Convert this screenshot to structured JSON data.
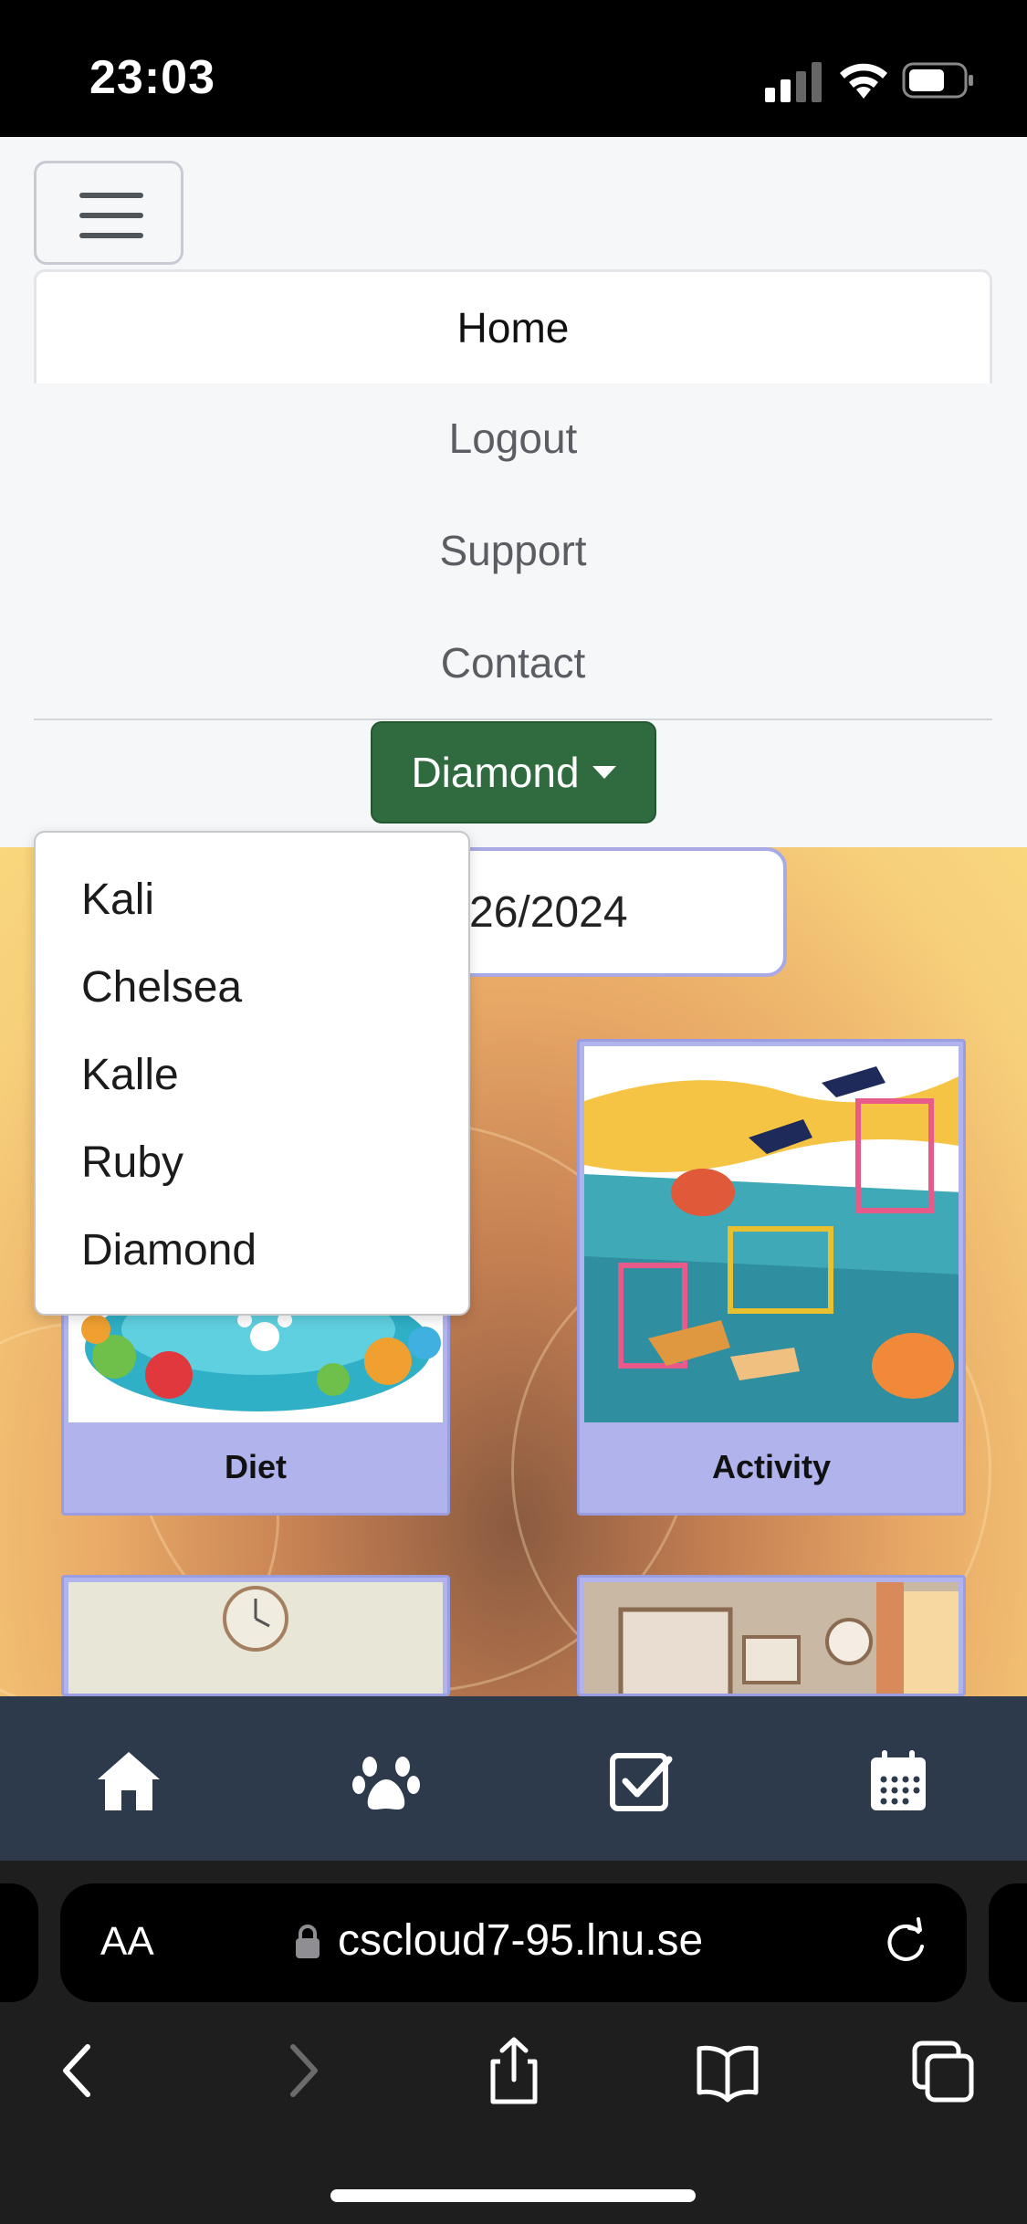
{
  "status": {
    "time": "23:03"
  },
  "nav": {
    "items": [
      {
        "label": "Home"
      },
      {
        "label": "Logout"
      },
      {
        "label": "Support"
      },
      {
        "label": "Contact"
      }
    ],
    "dog_selector": {
      "selected": "Diamond"
    }
  },
  "dropdown": {
    "options": [
      "Kali",
      "Chelsea",
      "Kalle",
      "Ruby",
      "Diamond"
    ]
  },
  "date_field": {
    "value": "26/2024"
  },
  "cards": [
    {
      "label": "Diet"
    },
    {
      "label": "Activity"
    }
  ],
  "bottom_nav": {
    "icons": [
      "home-icon",
      "paw-icon",
      "checkbox-icon",
      "calendar-icon"
    ]
  },
  "browser": {
    "text_size": "AA",
    "url": "cscloud7-95.lnu.se"
  },
  "colors": {
    "accent_green": "#2f6b3f",
    "card_purple": "#b1b3ec",
    "nav_dark": "#2c3a4c"
  }
}
